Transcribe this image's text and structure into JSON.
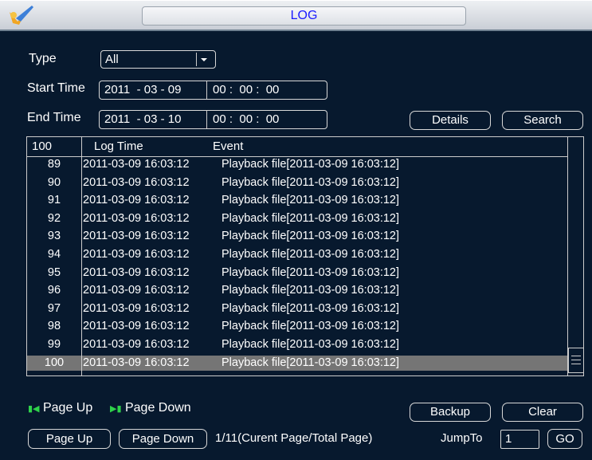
{
  "window": {
    "title": "LOG"
  },
  "filters": {
    "type_label": "Type",
    "type_value": "All",
    "start_label": "Start Time",
    "start_date": "2011  - 03 - 09",
    "start_time": "00 :  00 :  00",
    "end_label": "End Time",
    "end_date": "2011  - 03 - 10",
    "end_time": "00 :  00 :  00"
  },
  "buttons": {
    "details": "Details",
    "search": "Search",
    "backup": "Backup",
    "clear": "Clear",
    "page_up": "Page Up",
    "page_down": "Page Down",
    "go": "GO"
  },
  "table": {
    "headers": [
      "100",
      "Log Time",
      "Event"
    ],
    "rows": [
      {
        "num": "89",
        "time": "2011-03-09 16:03:12",
        "event": "Playback file[2011-03-09 16:03:12]"
      },
      {
        "num": "90",
        "time": "2011-03-09 16:03:12",
        "event": "Playback file[2011-03-09 16:03:12]"
      },
      {
        "num": "91",
        "time": "2011-03-09 16:03:12",
        "event": "Playback file[2011-03-09 16:03:12]"
      },
      {
        "num": "92",
        "time": "2011-03-09 16:03:12",
        "event": "Playback file[2011-03-09 16:03:12]"
      },
      {
        "num": "93",
        "time": "2011-03-09 16:03:12",
        "event": "Playback file[2011-03-09 16:03:12]"
      },
      {
        "num": "94",
        "time": "2011-03-09 16:03:12",
        "event": "Playback file[2011-03-09 16:03:12]"
      },
      {
        "num": "95",
        "time": "2011-03-09 16:03:12",
        "event": "Playback file[2011-03-09 16:03:12]"
      },
      {
        "num": "96",
        "time": "2011-03-09 16:03:12",
        "event": "Playback file[2011-03-09 16:03:12]"
      },
      {
        "num": "97",
        "time": "2011-03-09 16:03:12",
        "event": "Playback file[2011-03-09 16:03:12]"
      },
      {
        "num": "98",
        "time": "2011-03-09 16:03:12",
        "event": "Playback file[2011-03-09 16:03:12]"
      },
      {
        "num": "99",
        "time": "2011-03-09 16:03:12",
        "event": "Playback file[2011-03-09 16:03:12]"
      },
      {
        "num": "100",
        "time": "2011-03-09 16:03:12",
        "event": "Playback file[2011-03-09 16:03:12]"
      }
    ],
    "selected_row": "100"
  },
  "nav": {
    "page_up_hint": "Page Up",
    "page_down_hint": "Page Down",
    "page_info": "1/11(Curent Page/Total Page)",
    "jump_label": "JumpTo",
    "jump_value": "1"
  },
  "colors": {
    "background": "#07192e",
    "selected_row": "#757575",
    "title_text": "#1a1aff",
    "hint_icon": "#2fd24a"
  },
  "icons": {
    "logo": "brand-logo-icon",
    "dropdown": "chevron-down-icon",
    "page_up_hint": "skip-back-icon",
    "page_down_hint": "skip-forward-icon"
  }
}
